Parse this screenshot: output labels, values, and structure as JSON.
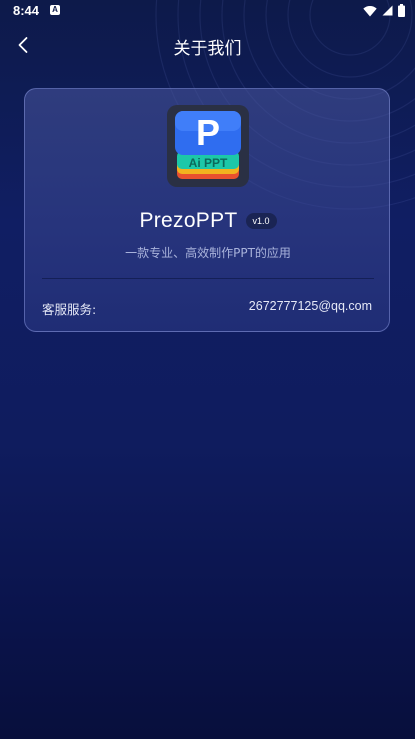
{
  "status_bar": {
    "time": "8:44",
    "notification_icon": "a-icon",
    "icons": [
      "wifi-icon",
      "signal-icon",
      "battery-icon"
    ]
  },
  "header": {
    "title": "关于我们",
    "back_icon": "chevron-left-icon"
  },
  "app": {
    "logo_letter": "P",
    "logo_caption": "Ai PPT",
    "name": "PrezoPPT",
    "version": "v1.0",
    "description": "一款专业、高效制作PPT的应用"
  },
  "contact": {
    "label": "客服服务:",
    "value": "2672777125@qq.com"
  },
  "colors": {
    "background_top": "#0d1a4a",
    "background_mid": "#101e63",
    "card_border": "#96a5eb",
    "text_secondary": "#a9b3db",
    "logo_blue": "#2f6df0",
    "logo_teal": "#1cc8a8"
  }
}
